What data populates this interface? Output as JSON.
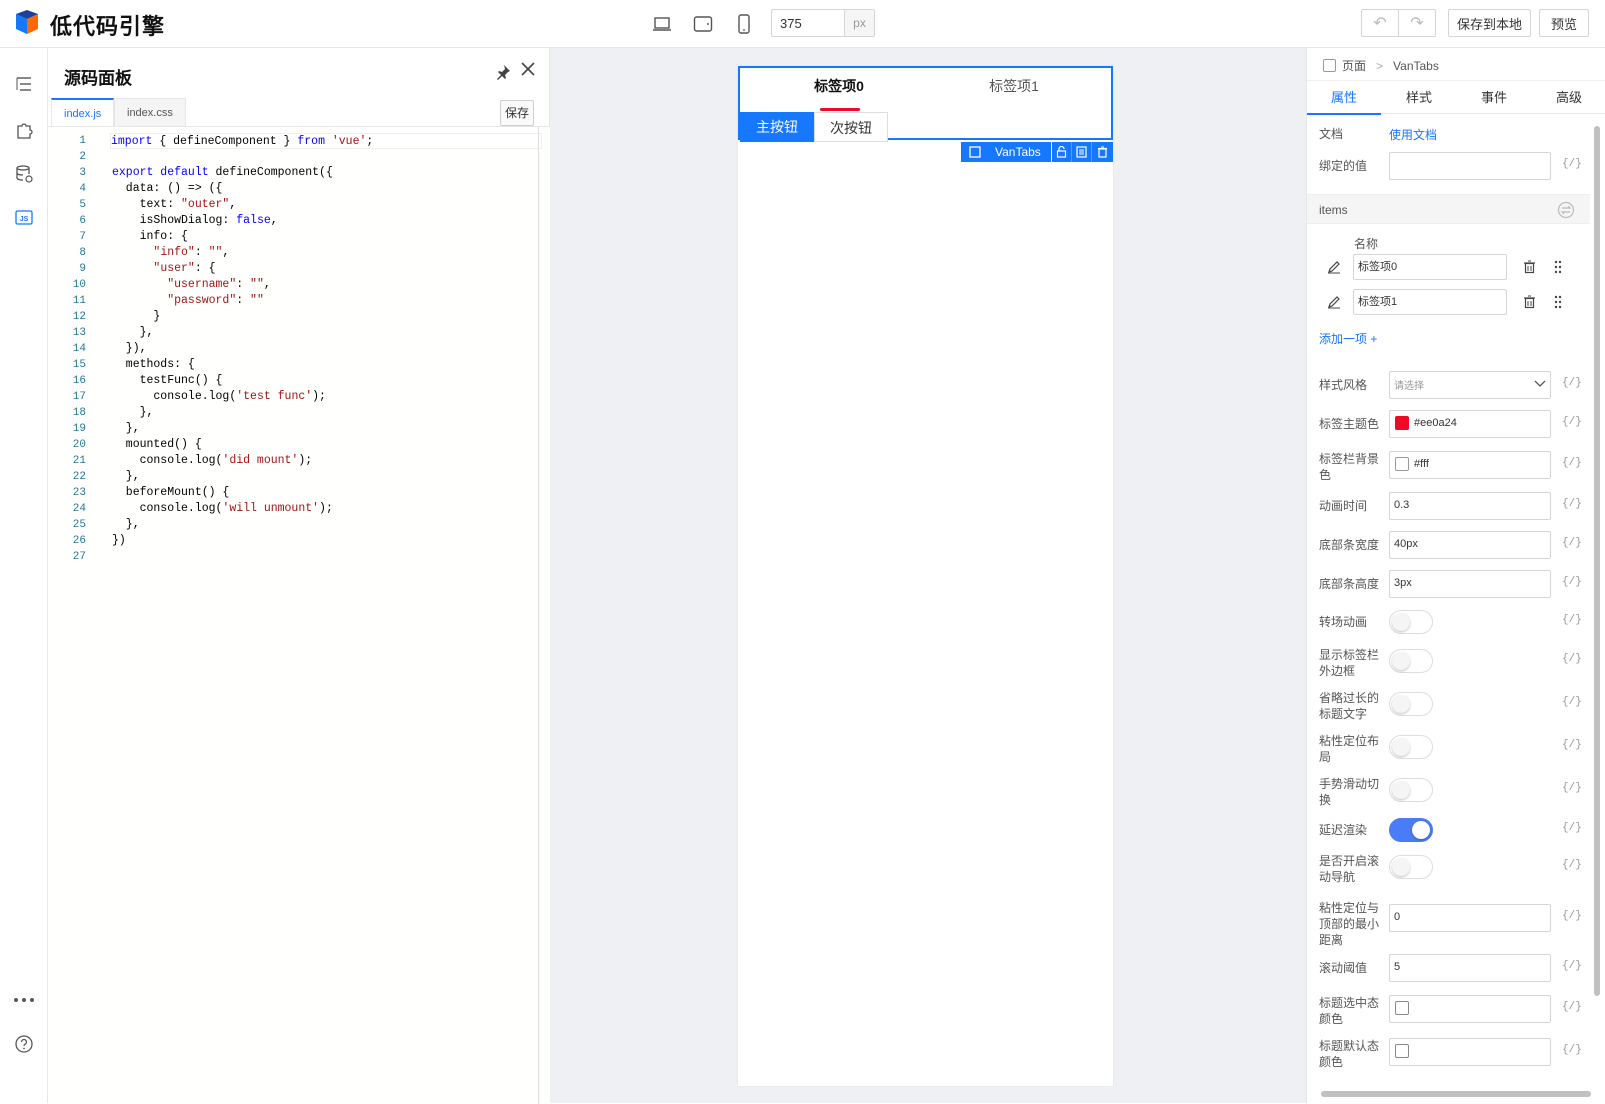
{
  "app": {
    "title": "低代码引擎"
  },
  "toolbar": {
    "width_value": "375",
    "width_unit": "px",
    "save_local_label": "保存到本地",
    "preview_label": "预览"
  },
  "code_panel": {
    "title": "源码面板",
    "tabs": [
      {
        "label": "index.js"
      },
      {
        "label": "index.css"
      }
    ],
    "save_label": "保存",
    "line_numbers": [
      "1",
      "2",
      "3",
      "4",
      "5",
      "6",
      "7",
      "8",
      "9",
      "10",
      "11",
      "12",
      "13",
      "14",
      "15",
      "16",
      "17",
      "18",
      "19",
      "20",
      "21",
      "22",
      "23",
      "24",
      "25",
      "26",
      "27"
    ]
  },
  "canvas": {
    "tabs": [
      {
        "label": "标签项0"
      },
      {
        "label": "标签项1"
      }
    ],
    "primary_button": "主按钮",
    "secondary_button": "次按钮",
    "selected_component": "VanTabs",
    "tab_accent": "#ee0a24",
    "selection_color": "#1677ff"
  },
  "props_panel": {
    "breadcrumb": {
      "root": "页面",
      "separator": ">",
      "current": "VanTabs"
    },
    "tabs": [
      {
        "label": "属性"
      },
      {
        "label": "样式"
      },
      {
        "label": "事件"
      },
      {
        "label": "高级"
      }
    ],
    "doc_label": "文档",
    "doc_link": "使用文档",
    "bind_label": "绑定的值",
    "items_section": "items",
    "items_header": "名称",
    "items": [
      {
        "value": "标签项0"
      },
      {
        "value": "标签项1"
      }
    ],
    "add_item": "添加一项 +",
    "expr_icon": "{/}",
    "fields": {
      "style": {
        "label": "样式风格",
        "placeholder": "请选择"
      },
      "theme_color": {
        "label": "标签主题色",
        "value": "#ee0a24"
      },
      "bg_color": {
        "label": "标签栏背景色",
        "value": "#fff"
      },
      "duration": {
        "label": "动画时间",
        "value": "0.3"
      },
      "line_width": {
        "label": "底部条宽度",
        "value": "40px"
      },
      "line_height": {
        "label": "底部条高度",
        "value": "3px"
      },
      "animated": {
        "label": "转场动画",
        "on": false
      },
      "border": {
        "label": "显示标签栏外边框",
        "on": false
      },
      "ellipsis": {
        "label": "省略过长的标题文字",
        "on": false
      },
      "sticky": {
        "label": "粘性定位布局",
        "on": false
      },
      "swipeable": {
        "label": "手势滑动切换",
        "on": false
      },
      "lazy_render": {
        "label": "延迟渲染",
        "on": true
      },
      "scrollspy": {
        "label": "是否开启滚动导航",
        "on": false
      },
      "offset_top": {
        "label": "粘性定位与顶部的最小距离",
        "value": "0"
      },
      "swipe_threshold": {
        "label": "滚动阈值",
        "value": "5"
      },
      "title_active_color": {
        "label": "标题选中态颜色"
      },
      "title_inactive_color": {
        "label": "标题默认态颜色"
      }
    }
  }
}
